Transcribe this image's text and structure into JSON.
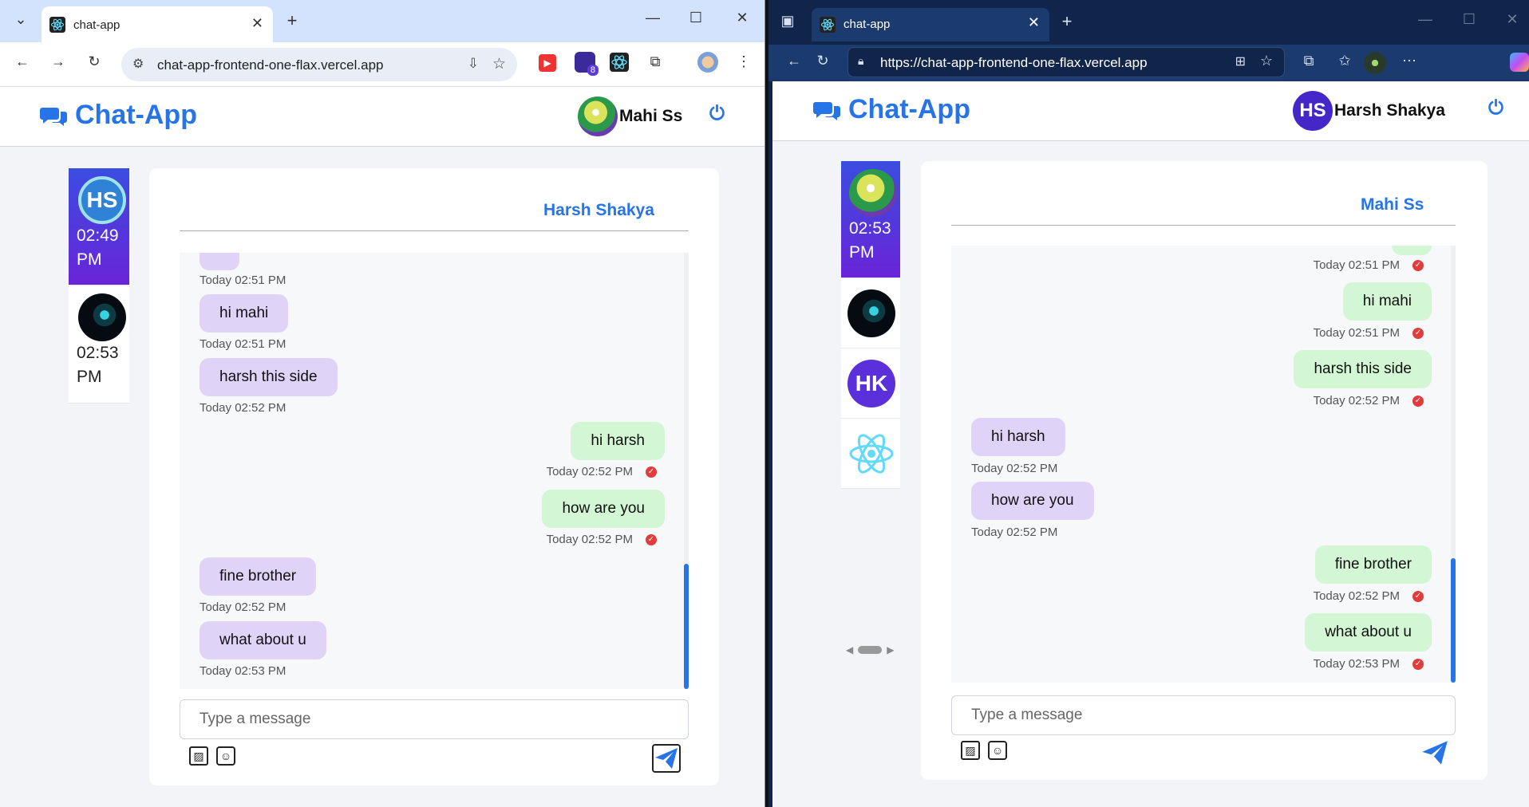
{
  "left_browser": {
    "tab_title": "chat-app",
    "url": "chat-app-frontend-one-flax.vercel.app",
    "extension_badge": "8"
  },
  "right_browser": {
    "tab_title": "chat-app",
    "url": "https://chat-app-frontend-one-flax.vercel.app"
  },
  "left_app": {
    "brand": "Chat-App",
    "user_name": "Mahi Ss",
    "sidebar": [
      {
        "initials": "HS",
        "time": "02:49 PM",
        "active": true
      },
      {
        "initials": "",
        "time": "02:53 PM",
        "active": false
      }
    ],
    "peer_name": "Harsh Shakya",
    "messages": [
      {
        "dir": "in",
        "text": "",
        "time": "Today 02:51 PM"
      },
      {
        "dir": "in",
        "text": "hi mahi",
        "time": "Today 02:51 PM"
      },
      {
        "dir": "in",
        "text": "harsh this side",
        "time": "Today 02:52 PM"
      },
      {
        "dir": "out",
        "text": "hi harsh",
        "time": "Today 02:52 PM"
      },
      {
        "dir": "out",
        "text": "how are you",
        "time": "Today 02:52 PM"
      },
      {
        "dir": "in",
        "text": "fine brother",
        "time": "Today 02:52 PM"
      },
      {
        "dir": "in",
        "text": "what about u",
        "time": "Today 02:53 PM"
      }
    ],
    "input_placeholder": "Type a message"
  },
  "right_app": {
    "brand": "Chat-App",
    "user_initials": "HS",
    "user_name": "Harsh Shakya",
    "sidebar": [
      {
        "initials": "",
        "time": "02:53 PM",
        "active": true
      },
      {
        "initials": "",
        "time": "",
        "active": false
      },
      {
        "initials": "HK",
        "time": "",
        "active": false
      },
      {
        "initials": "",
        "time": "",
        "active": false
      }
    ],
    "peer_name": "Mahi Ss",
    "messages": [
      {
        "dir": "out",
        "text": "",
        "time": "Today 02:51 PM"
      },
      {
        "dir": "out",
        "text": "hi mahi",
        "time": "Today 02:51 PM"
      },
      {
        "dir": "out",
        "text": "harsh this side",
        "time": "Today 02:52 PM"
      },
      {
        "dir": "in",
        "text": "hi harsh",
        "time": "Today 02:52 PM"
      },
      {
        "dir": "in",
        "text": "how are you",
        "time": "Today 02:52 PM"
      },
      {
        "dir": "out",
        "text": "fine brother",
        "time": "Today 02:52 PM"
      },
      {
        "dir": "out",
        "text": "what about u",
        "time": "Today 02:53 PM"
      }
    ],
    "input_placeholder": "Type a message"
  },
  "icons": {
    "tick": "check-circle",
    "send": "paper-plane",
    "image": "image",
    "emoji": "smiley",
    "power": "power",
    "chat": "chat-bubbles"
  }
}
